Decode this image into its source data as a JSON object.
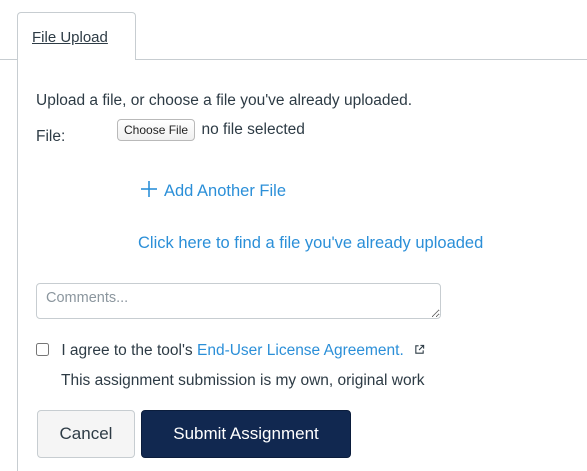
{
  "tabs": [
    {
      "label": "File Upload",
      "active": true
    }
  ],
  "upload": {
    "instructions": "Upload a file, or choose a file you've already uploaded.",
    "file_label": "File:",
    "choose_button_label": "Choose File",
    "no_file_text": "no file selected",
    "add_another_label": "Add Another File",
    "add_icon": "plus-icon",
    "find_existing_link": "Click here to find a file you've already uploaded"
  },
  "comments": {
    "placeholder": "Comments...",
    "value": ""
  },
  "agreement": {
    "checked": false,
    "prefix": "I agree to the tool's",
    "link_text": "End-User License Agreement.",
    "link_icon": "external-link-icon",
    "statement": "This assignment submission is my own, original work"
  },
  "actions": {
    "cancel_label": "Cancel",
    "submit_label": "Submit Assignment"
  },
  "colors": {
    "link": "#2b8fd8",
    "primary_button": "#112850",
    "border": "#c7cdd1",
    "text": "#2d3b45"
  }
}
